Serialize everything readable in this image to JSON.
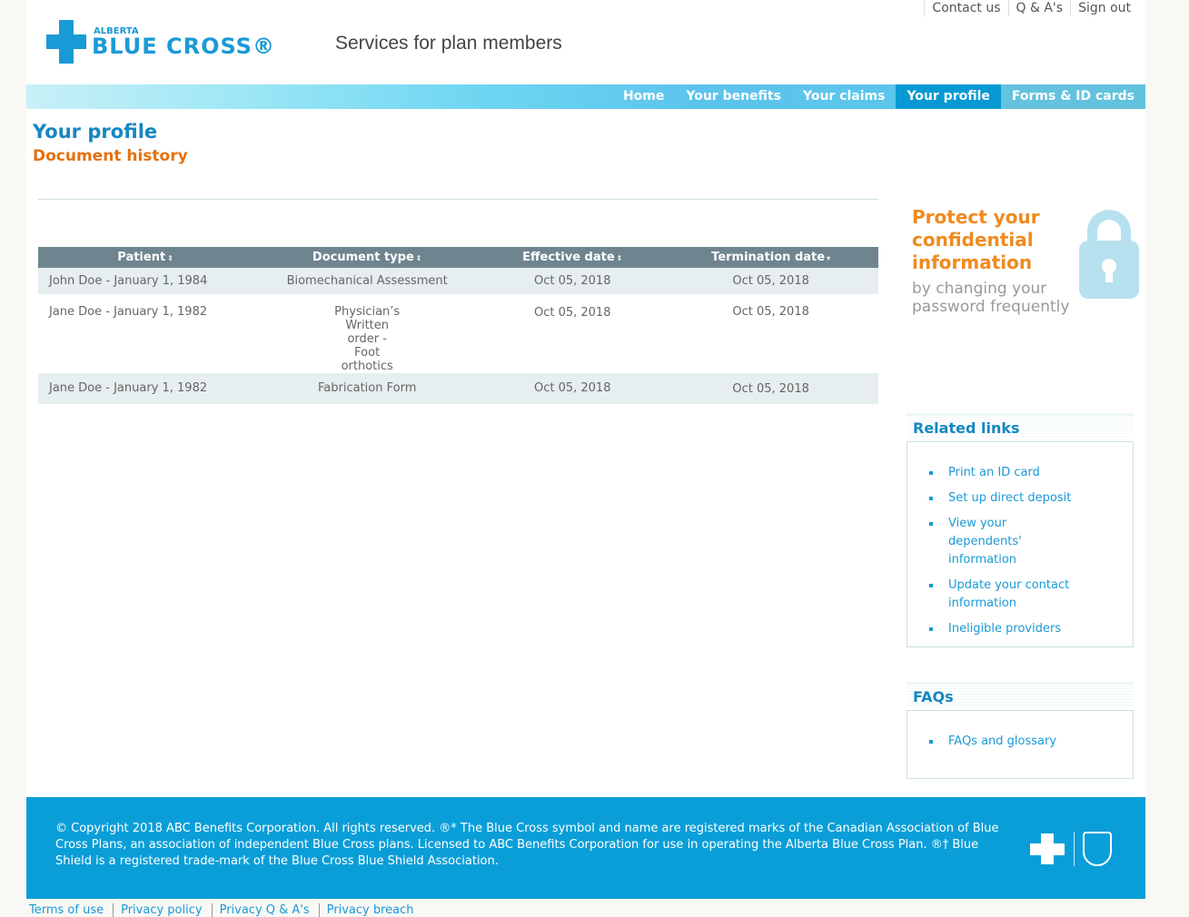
{
  "header": {
    "logo_small": "ALBERTA",
    "logo_big": "BLUE CROSS®",
    "tagline": "Services for plan members",
    "top_links": [
      "Contact us",
      "Q & A's",
      "Sign out"
    ]
  },
  "nav": {
    "items": [
      "Home",
      "Your benefits",
      "Your claims",
      "Your profile",
      "Forms & ID cards"
    ],
    "active": "Your profile"
  },
  "page": {
    "title": "Your profile",
    "subtitle": "Document history"
  },
  "table": {
    "columns": [
      {
        "label": "Patient",
        "sort": "⇕"
      },
      {
        "label": "Document type",
        "sort": "⇕"
      },
      {
        "label": "Effective date",
        "sort": "⇕"
      },
      {
        "label": "Termination date",
        "sort": "▾"
      }
    ],
    "rows": [
      [
        "John Doe - January 1, 1984",
        "Biomechanical Assessment",
        "Oct 05, 2018",
        "Oct 05, 2018"
      ],
      [
        "Jane Doe - January 1, 1982",
        "Physician’s Written order - Foot orthotics",
        "Oct 05, 2018",
        "Oct 05, 2018"
      ],
      [
        "Jane Doe - January 1, 1982",
        "Fabrication Form",
        "Oct 05, 2018",
        "Oct 05, 2018"
      ]
    ]
  },
  "promo": {
    "title": "Protect your confidential information",
    "subtitle": "by changing your password frequently"
  },
  "related_links": {
    "title": "Related links",
    "items": [
      "Print an ID card",
      "Set up direct deposit",
      "View your dependents' information",
      "Update your contact information",
      "Ineligible providers"
    ]
  },
  "faqs": {
    "title": "FAQs",
    "items": [
      "FAQs and glossary"
    ]
  },
  "footer": {
    "text": "© Copyright 2018 ABC Benefits Corporation. All rights reserved. ®* The Blue Cross symbol and name are registered marks of the Canadian Association of Blue Cross Plans, an association of independent Blue Cross plans. Licensed to ABC Benefits Corporation for use in operating the Alberta Blue Cross Plan. ®† Blue Shield is a registered trade-mark of the Blue Cross Blue Shield Association.",
    "bottom_links": [
      "Terms of use",
      "Privacy policy",
      "Privacy Q & A's",
      "Privacy breach"
    ]
  },
  "colors": {
    "brand": "#1a9ad6",
    "accent": "#e5700f",
    "nav_active": "#0699d4",
    "table_header": "#6e8590"
  }
}
